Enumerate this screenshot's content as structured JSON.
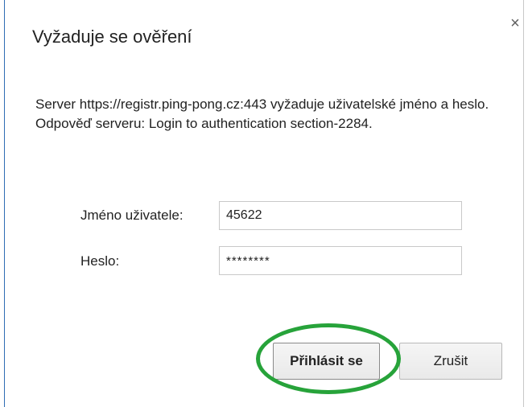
{
  "dialog": {
    "title": "Vyžaduje se ověření",
    "close_symbol": "×",
    "message": "Server https://registr.ping-pong.cz:443 vyžaduje uživatelské jméno a heslo. Odpověď serveru: Login to authentication section-2284."
  },
  "form": {
    "username_label": "Jméno uživatele:",
    "username_value": "45622",
    "password_label": "Heslo:",
    "password_value": "********"
  },
  "buttons": {
    "login_label": "Přihlásit se",
    "cancel_label": "Zrušit"
  },
  "icons": {
    "close": "close-icon"
  },
  "colors": {
    "highlight": "#27a33a",
    "accent_border": "#2e6db4"
  }
}
